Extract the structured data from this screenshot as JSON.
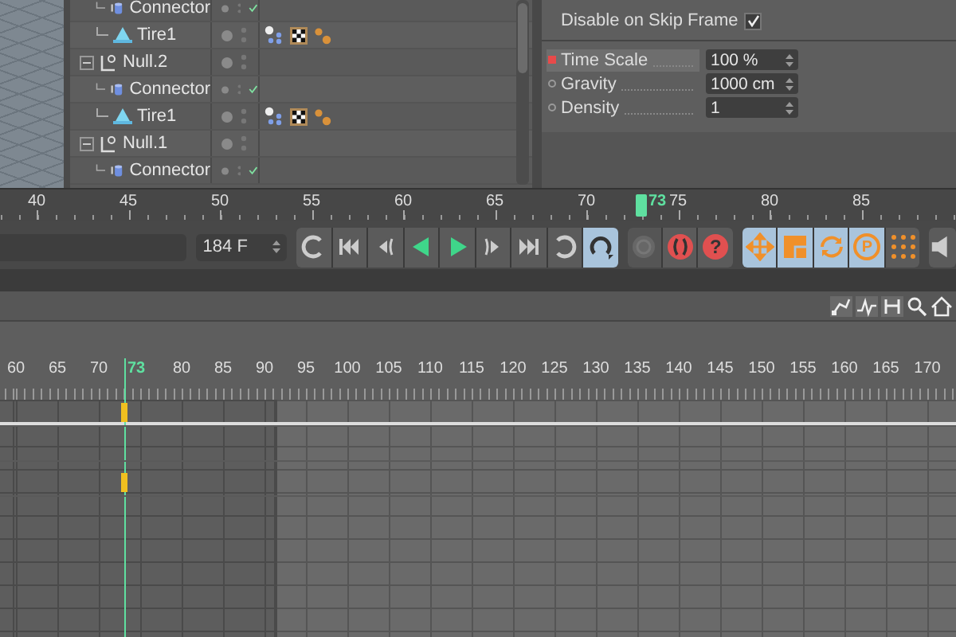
{
  "outliner": {
    "items": [
      {
        "children": [
          {
            "name": "Connector",
            "kind": "connector",
            "checked": true
          },
          {
            "name": "Tire1",
            "kind": "tire",
            "checked": false
          }
        ]
      },
      {
        "name": "Null.2",
        "kind": "null",
        "checked": false,
        "expanded": true,
        "children": [
          {
            "name": "Connector",
            "kind": "connector",
            "checked": true
          },
          {
            "name": "Tire1",
            "kind": "tire",
            "checked": false
          }
        ]
      },
      {
        "name": "Null.1",
        "kind": "null",
        "checked": false,
        "expanded": true,
        "children": [
          {
            "name": "Connector",
            "kind": "connector",
            "checked": true
          }
        ]
      }
    ]
  },
  "attributes": {
    "checkbox": {
      "label": "Disable on Skip Frame",
      "checked": true
    },
    "fields": [
      {
        "label": "Time Scale",
        "value": "100 %",
        "keyed": true
      },
      {
        "label": "Gravity",
        "value": "1000 cm",
        "keyed": false
      },
      {
        "label": "Density",
        "value": "1",
        "keyed": false
      }
    ]
  },
  "timeline": {
    "ticks": [
      "40",
      "45",
      "50",
      "55",
      "60",
      "65",
      "70",
      "75",
      "80",
      "85"
    ],
    "playhead": {
      "label": "73",
      "level": 0.67
    }
  },
  "transport": {
    "end_frame": "184 F",
    "buttons": [
      {
        "kind": "loop-start",
        "selected": false,
        "disabled": false
      },
      {
        "kind": "go-to-start",
        "selected": false,
        "disabled": false
      },
      {
        "kind": "previous-key",
        "selected": false,
        "disabled": false
      },
      {
        "kind": "play-backward",
        "selected": false,
        "disabled": false
      },
      {
        "kind": "play",
        "selected": false,
        "disabled": false
      },
      {
        "kind": "next-key",
        "selected": false,
        "disabled": false
      },
      {
        "kind": "go-to-end",
        "selected": false,
        "disabled": false
      },
      {
        "kind": "loop-end",
        "selected": false,
        "disabled": false
      },
      {
        "kind": "loop",
        "selected": true,
        "disabled": false
      },
      {
        "kind": "record",
        "selected": false,
        "disabled": true
      },
      {
        "kind": "autokey",
        "selected": false,
        "disabled": false
      },
      {
        "kind": "help",
        "glyph": "?",
        "selected": false,
        "disabled": false
      },
      {
        "kind": "move",
        "selected": true,
        "disabled": false
      },
      {
        "kind": "scale",
        "selected": true,
        "disabled": false
      },
      {
        "kind": "rotate",
        "selected": true,
        "disabled": false
      },
      {
        "kind": "parameter",
        "glyph": "P",
        "selected": true,
        "disabled": false
      },
      {
        "kind": "dot-grid",
        "selected": false,
        "disabled": false
      },
      {
        "kind": "speaker",
        "selected": false,
        "disabled": false
      }
    ]
  },
  "dopesheet": {
    "ticks_before": [
      "60",
      "65",
      "70"
    ],
    "ticks_after": [
      "80",
      "85",
      "90",
      "95",
      "100",
      "105",
      "110",
      "115",
      "120",
      "125",
      "130",
      "135",
      "140",
      "145",
      "150",
      "155",
      "160",
      "165",
      "170"
    ],
    "playhead": {
      "label": "73",
      "level": 0.13
    },
    "tracks": [
      {
        "keyframe": true
      },
      {
        "keyframe": false
      },
      {
        "keyframe": true
      }
    ]
  }
}
